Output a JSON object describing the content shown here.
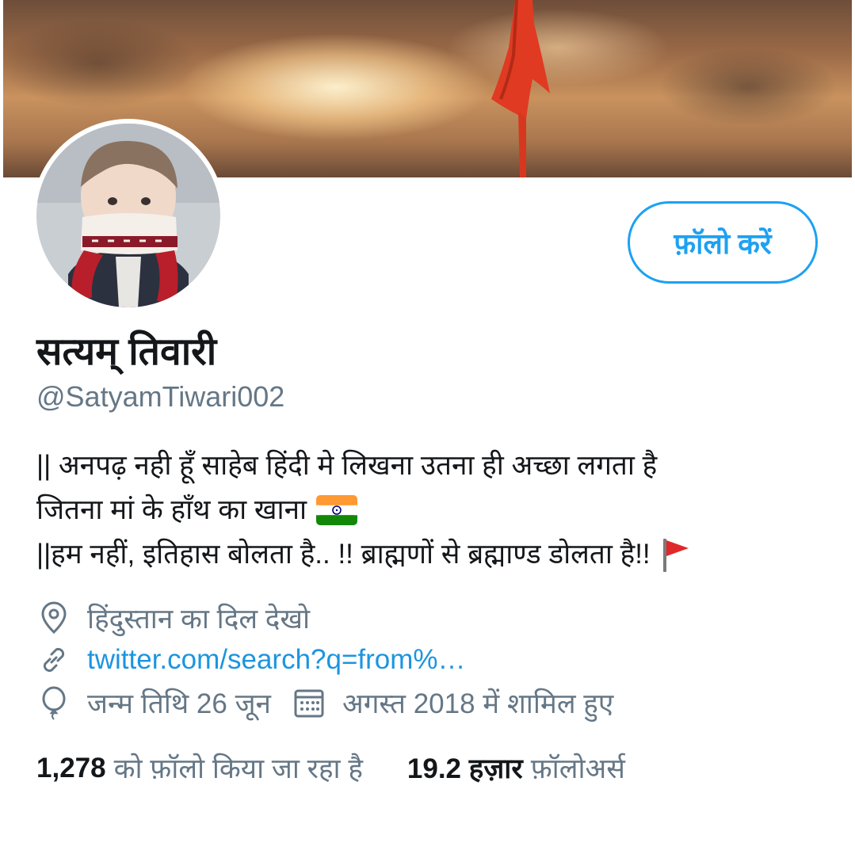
{
  "profile": {
    "name": "सत्यम् तिवारी",
    "handle": "@SatyamTiwari002",
    "follow_button": "फ़ॉलो करें",
    "bio": {
      "line1": "|| अनपढ़ नही हूँ साहेब हिंदी मे लिखना उतना ही अच्छा लगता है",
      "line2": "जितना मां के हाँथ का खाना",
      "line3": "||हम नहीं, इतिहास बोलता है.. !! ब्राह्मणों से ब्रह्माण्ड डोलता है!!"
    },
    "location": "हिंदुस्तान का दिल देखो",
    "website": "twitter.com/search?q=from%…",
    "birthday": "जन्म तिथि 26 जून",
    "joined": "अगस्त 2018 में शामिल हुए",
    "following": {
      "count": "1,278",
      "label": "को फ़ॉलो किया जा रहा है"
    },
    "followers": {
      "count": "19.2 हज़ार",
      "label": "फ़ॉलोअर्स"
    }
  },
  "icons": {
    "location": "location-pin-icon",
    "link": "link-icon",
    "birthday": "balloon-icon",
    "calendar": "calendar-icon",
    "india_flag": "india-flag-emoji",
    "red_flag": "red-flag-emoji"
  },
  "colors": {
    "accent": "#1da1f2",
    "link": "#1b95e0",
    "text_primary": "#14171a",
    "text_secondary": "#657786"
  }
}
